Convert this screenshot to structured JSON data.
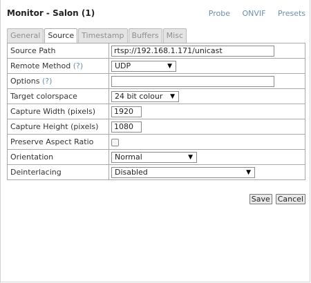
{
  "header": {
    "title": "Monitor - Salon (1)",
    "links": [
      "Probe",
      "ONVIF",
      "Presets"
    ]
  },
  "tabs": [
    {
      "label": "General",
      "active": false
    },
    {
      "label": "Source",
      "active": true
    },
    {
      "label": "Timestamp",
      "active": false
    },
    {
      "label": "Buffers",
      "active": false
    },
    {
      "label": "Misc",
      "active": false
    }
  ],
  "form": {
    "source_path": {
      "label": "Source Path",
      "value": "rtsp://192.168.1.171/unicast"
    },
    "remote_method": {
      "label": "Remote Method",
      "help": "(?)",
      "value": "UDP"
    },
    "options": {
      "label": "Options",
      "help": "(?)",
      "value": ""
    },
    "target_colorspace": {
      "label": "Target colorspace",
      "value": "24 bit colour"
    },
    "capture_width": {
      "label": "Capture Width (pixels)",
      "value": "1920"
    },
    "capture_height": {
      "label": "Capture Height (pixels)",
      "value": "1080"
    },
    "preserve_aspect_ratio": {
      "label": "Preserve Aspect Ratio",
      "checked": false
    },
    "orientation": {
      "label": "Orientation",
      "value": "Normal"
    },
    "deinterlacing": {
      "label": "Deinterlacing",
      "value": "Disabled"
    }
  },
  "buttons": {
    "save_label": "Save",
    "cancel_label": "Cancel"
  },
  "icons": {
    "dropdown_caret": "chevron-down-icon"
  }
}
